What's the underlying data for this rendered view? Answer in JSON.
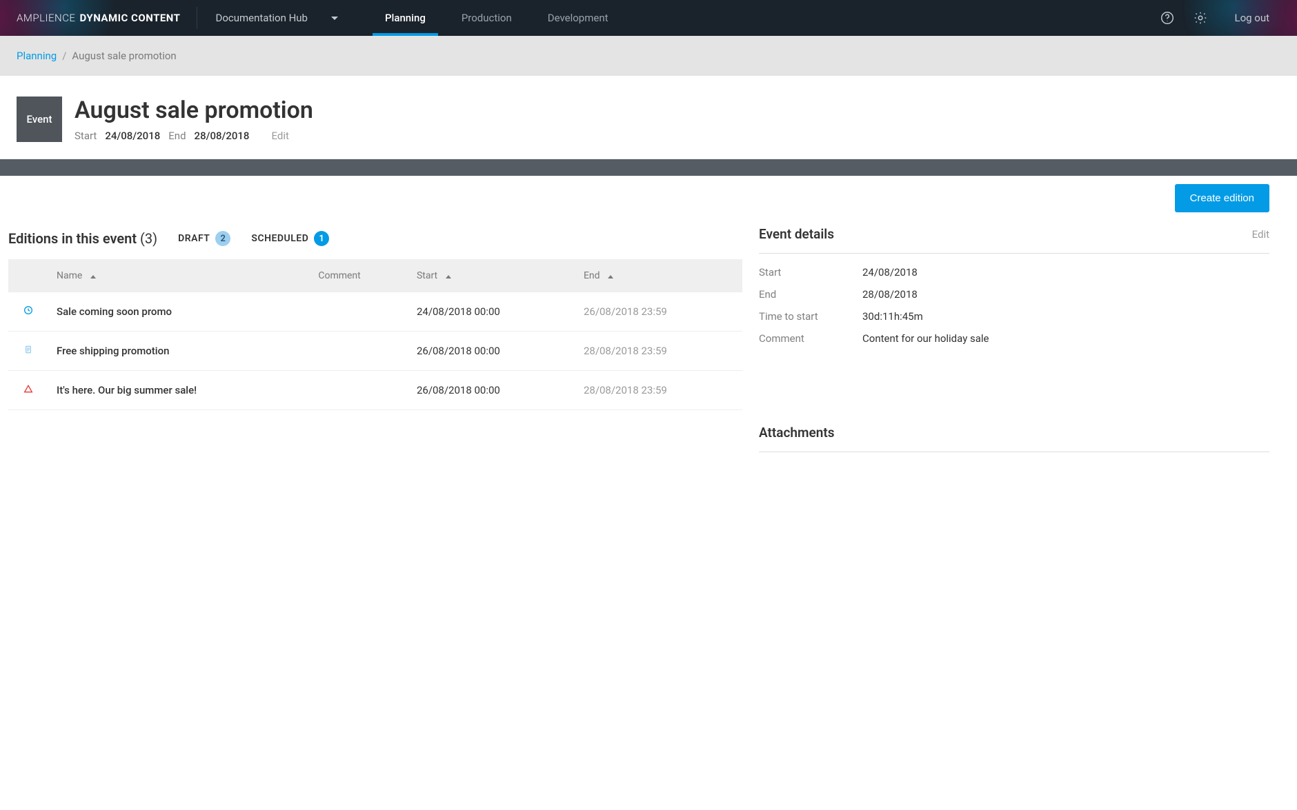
{
  "brand": {
    "light": "AMPLIENCE",
    "bold": "DYNAMIC CONTENT"
  },
  "hub": {
    "label": "Documentation Hub"
  },
  "nav": {
    "tabs": [
      {
        "label": "Planning",
        "active": true
      },
      {
        "label": "Production",
        "active": false
      },
      {
        "label": "Development",
        "active": false
      }
    ],
    "logout": "Log out"
  },
  "breadcrumb": {
    "root": "Planning",
    "sep": "/",
    "current": "August sale promotion"
  },
  "event": {
    "badge": "Event",
    "title": "August sale promotion",
    "start_label": "Start",
    "start_date": "24/08/2018",
    "end_label": "End",
    "end_date": "28/08/2018",
    "edit_label": "Edit"
  },
  "actions": {
    "create_edition": "Create edition"
  },
  "editions": {
    "title": "Editions in this event",
    "count": "(3)",
    "statuses": {
      "draft_label": "DRAFT",
      "draft_count": "2",
      "scheduled_label": "SCHEDULED",
      "scheduled_count": "1"
    },
    "columns": {
      "name": "Name",
      "comment": "Comment",
      "start": "Start",
      "end": "End"
    },
    "rows": [
      {
        "status": "scheduled",
        "name": "Sale coming soon promo",
        "comment": "",
        "start": "24/08/2018 00:00",
        "end": "26/08/2018 23:59"
      },
      {
        "status": "draft",
        "name": "Free shipping promotion",
        "comment": "",
        "start": "26/08/2018 00:00",
        "end": "28/08/2018 23:59"
      },
      {
        "status": "warning",
        "name": "It's here. Our big summer sale!",
        "comment": "",
        "start": "26/08/2018 00:00",
        "end": "28/08/2018 23:59"
      }
    ]
  },
  "details": {
    "title": "Event details",
    "edit_label": "Edit",
    "fields": {
      "start_label": "Start",
      "start_value": "24/08/2018",
      "end_label": "End",
      "end_value": "28/08/2018",
      "ttstart_label": "Time to start",
      "ttstart_value": "30d:11h:45m",
      "comment_label": "Comment",
      "comment_value": "Content for our holiday sale"
    }
  },
  "attachments": {
    "title": "Attachments"
  }
}
